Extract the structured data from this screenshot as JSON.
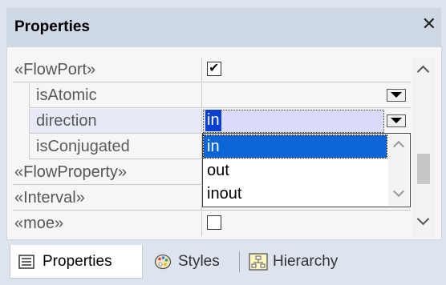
{
  "window": {
    "title": "Properties"
  },
  "rows": [
    {
      "label": "«FlowPort»",
      "kind": "stereotype"
    },
    {
      "label": "isAtomic",
      "kind": "attribute"
    },
    {
      "label": "direction",
      "kind": "attribute"
    },
    {
      "label": "isConjugated",
      "kind": "attribute"
    },
    {
      "label": "«FlowProperty»",
      "kind": "stereotype"
    },
    {
      "label": "«Interval»",
      "kind": "stereotype"
    },
    {
      "label": "«moe»",
      "kind": "stereotype"
    }
  ],
  "values": {
    "flowport_checked": true,
    "moe_checked": false,
    "direction_selected": "in"
  },
  "dropdown": {
    "options": [
      "in",
      "out",
      "inout"
    ],
    "selected": "in"
  },
  "tabs": [
    {
      "label": "Properties",
      "icon": "properties-icon",
      "active": true
    },
    {
      "label": "Styles",
      "icon": "styles-icon",
      "active": false
    },
    {
      "label": "Hierarchy",
      "icon": "hierarchy-icon",
      "active": false
    }
  ],
  "colors": {
    "selection": "#0a66d6",
    "title_bar": "#cfd9e6",
    "row_highlight": "#d9dbf8"
  }
}
